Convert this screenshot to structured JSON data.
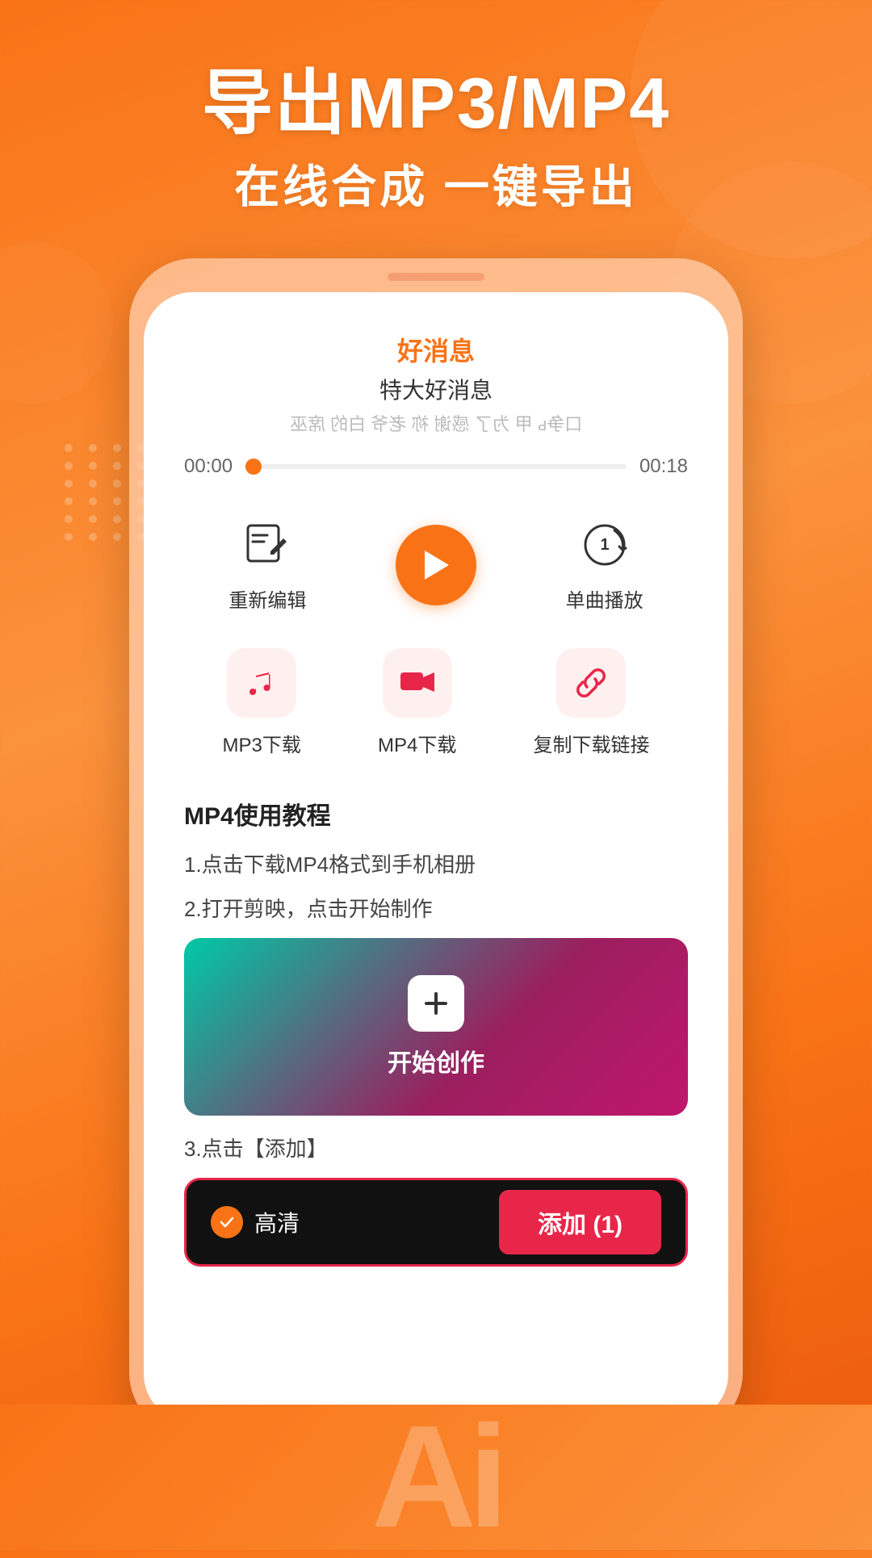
{
  "header": {
    "title": "导出MP3/MP4",
    "subtitle": "在线合成 一键导出"
  },
  "player": {
    "song_title": "好消息",
    "song_subtitle": "特大好消息",
    "lyrics_preview": "口争ь 甲 为了 感谢 祢 老爷 白的 席巫",
    "time_start": "00:00",
    "time_end": "00:18",
    "progress_percent": 2
  },
  "actions_row1": [
    {
      "id": "edit",
      "label": "重新编辑"
    },
    {
      "id": "play",
      "label": ""
    },
    {
      "id": "single",
      "label": "单曲播放"
    }
  ],
  "actions_row2": [
    {
      "id": "mp3",
      "label": "MP3下载"
    },
    {
      "id": "mp4",
      "label": "MP4下载"
    },
    {
      "id": "copy",
      "label": "复制下载链接"
    }
  ],
  "tutorial": {
    "title": "MP4使用教程",
    "steps": [
      "1.点击下载MP4格式到手机相册",
      "2.打开剪映，点击开始制作"
    ],
    "creation_label": "开始创作",
    "step3": "3.点击【添加】",
    "hd_label": "高清",
    "add_label": "添加 (1)"
  },
  "bottom": {
    "ai_text": "Ai"
  },
  "colors": {
    "primary": "#f97316",
    "accent": "#e8264a",
    "text_dark": "#222",
    "text_mid": "#444",
    "bg_white": "#ffffff"
  }
}
